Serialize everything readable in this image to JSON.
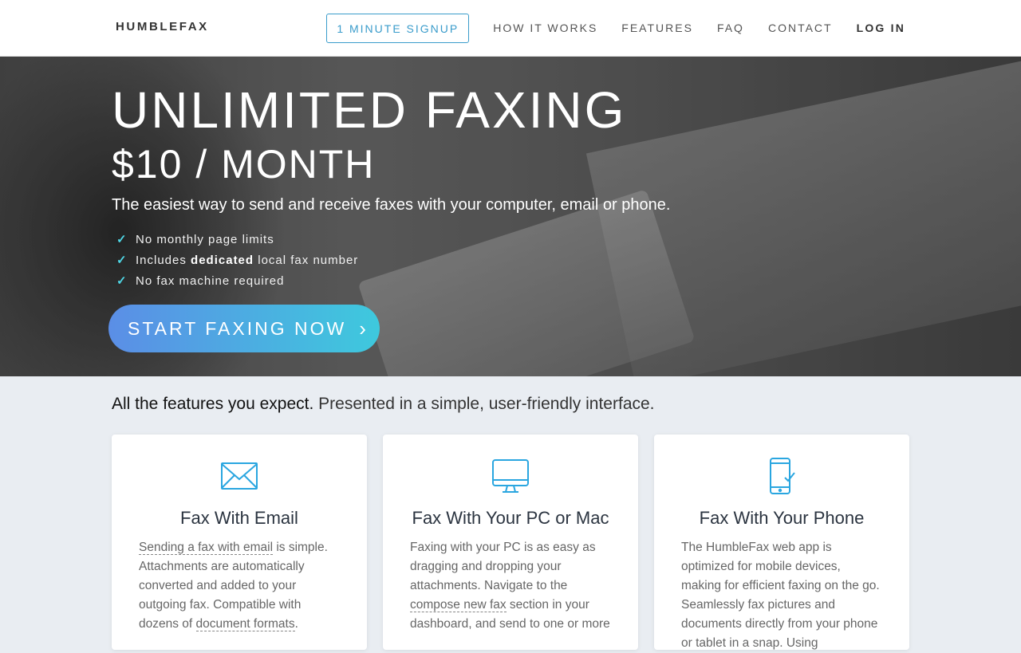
{
  "nav": {
    "brand": "HUMBLEFAX",
    "signup": "1 MINUTE SIGNUP",
    "how_it_works": "HOW IT WORKS",
    "features": "FEATURES",
    "faq": "FAQ",
    "contact": "CONTACT",
    "login": "LOG IN"
  },
  "hero": {
    "title": "UNLIMITED FAXING",
    "price": "$10 / MONTH",
    "subtitle": "The easiest way to send and receive faxes with your computer, email or phone.",
    "check_icon": "✓",
    "checks": {
      "c1": "No monthly page limits",
      "c2_pre": "Includes ",
      "c2_bold": "dedicated",
      "c2_post": " local fax number",
      "c3": "No fax machine required"
    },
    "cta": "START FAXING NOW",
    "cta_chevron": "›"
  },
  "features": {
    "heading_strong": "All the features you expect.",
    "heading_rest": " Presented in a simple, user-friendly interface.",
    "cards": [
      {
        "icon": "envelope-icon",
        "title": "Fax With Email",
        "link1": "Sending a fax with email",
        "text1": " is simple. Attachments are automatically converted and added to your outgoing fax. Compatible with dozens of ",
        "link2": "document formats",
        "text2": "."
      },
      {
        "icon": "monitor-icon",
        "title": "Fax With Your PC or Mac",
        "text1": "Faxing with your PC is as easy as dragging and dropping your attachments. Navigate to the ",
        "link1": "compose new fax",
        "text2": " section in your dashboard, and send to one or more"
      },
      {
        "icon": "phone-check-icon",
        "title": "Fax With Your Phone",
        "text1": "The HumbleFax web app is optimized for mobile devices, making for efficient faxing on the go. Seamlessly fax pictures and documents directly from your phone or tablet in a snap. Using"
      }
    ]
  },
  "colors": {
    "accent": "#3a9ccb",
    "cta_start": "#5b8ee6",
    "cta_end": "#3ec9dd",
    "check": "#4fd7e6",
    "icon": "#2aa6e0"
  }
}
